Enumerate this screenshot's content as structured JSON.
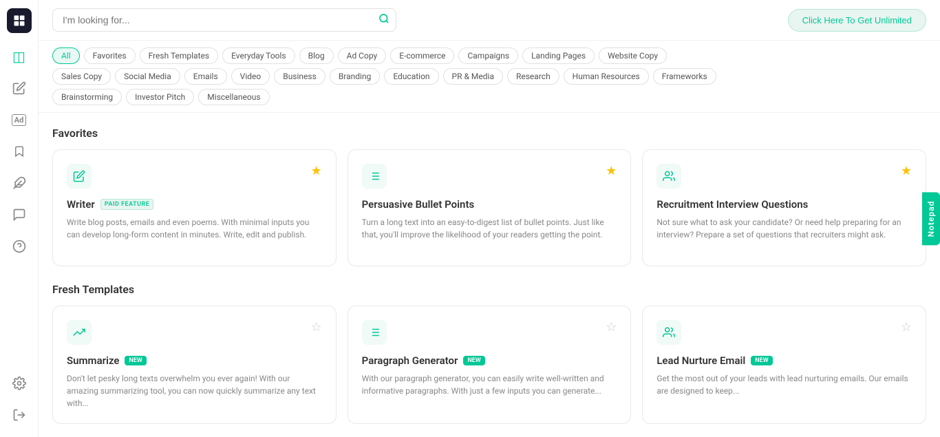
{
  "sidebar": {
    "logo_label": "Logo",
    "items": [
      {
        "name": "dashboard-icon",
        "icon": "⊞",
        "active": false
      },
      {
        "name": "layers-icon",
        "icon": "◫",
        "active": true
      },
      {
        "name": "edit-icon",
        "icon": "✏",
        "active": false
      },
      {
        "name": "ad-icon",
        "icon": "Ad",
        "active": false
      },
      {
        "name": "bookmark-icon",
        "icon": "🔖",
        "active": false
      },
      {
        "name": "puzzle-icon",
        "icon": "✦",
        "active": false
      },
      {
        "name": "comment-icon",
        "icon": "💬",
        "active": false
      },
      {
        "name": "help-icon",
        "icon": "?",
        "active": false
      }
    ],
    "bottom_items": [
      {
        "name": "settings-icon",
        "icon": "⚙",
        "active": false
      },
      {
        "name": "logout-icon",
        "icon": "→",
        "active": false
      }
    ]
  },
  "topbar": {
    "search_placeholder": "I'm looking for...",
    "unlimited_button": "Click Here To Get Unlimited"
  },
  "filters": {
    "rows": [
      [
        "All",
        "Favorites",
        "Fresh Templates",
        "Everyday Tools",
        "Blog",
        "Ad Copy",
        "E-commerce",
        "Campaigns",
        "Landing Pages",
        "Website Copy"
      ],
      [
        "Sales Copy",
        "Social Media",
        "Emails",
        "Video",
        "Business",
        "Branding",
        "Education",
        "PR & Media",
        "Research",
        "Human Resources",
        "Frameworks"
      ],
      [
        "Brainstorming",
        "Investor Pitch",
        "Miscellaneous"
      ]
    ],
    "active": "All"
  },
  "sections": [
    {
      "title": "Favorites",
      "cards": [
        {
          "icon": "✏",
          "title": "Writer",
          "badge": "PAID FEATURE",
          "badge_type": "paid",
          "starred": true,
          "description": "Write blog posts, emails and even poems. With minimal inputs you can develop long-form content in minutes. Write, edit and publish."
        },
        {
          "icon": "≡",
          "title": "Persuasive Bullet Points",
          "badge": "",
          "badge_type": "",
          "starred": true,
          "description": "Turn a long text into an easy-to-digest list of bullet points. Just like that, you'll improve the likelihood of your readers getting the point."
        },
        {
          "icon": "👤",
          "title": "Recruitment Interview Questions",
          "badge": "",
          "badge_type": "",
          "starred": true,
          "description": "Not sure what to ask your candidate? Or need help preparing for an interview? Prepare a set of questions that recruiters might ask."
        }
      ]
    },
    {
      "title": "Fresh Templates",
      "cards": [
        {
          "icon": "✂",
          "title": "Summarize",
          "badge": "NEW",
          "badge_type": "new",
          "starred": false,
          "description": "Don't let pesky long texts overwhelm you ever again! With our amazing summarizing tool, you can now quickly summarize any text with..."
        },
        {
          "icon": "≡",
          "title": "Paragraph Generator",
          "badge": "NEW",
          "badge_type": "new",
          "starred": false,
          "description": "With our paragraph generator, you can easily write well-written and informative paragraphs. With just a few inputs you can generate..."
        },
        {
          "icon": "👤",
          "title": "Lead Nurture Email",
          "badge": "NEW",
          "badge_type": "new",
          "starred": false,
          "description": "Get the most out of your leads with lead nurturing emails. Our emails are designed to keep..."
        }
      ]
    }
  ],
  "notepad": {
    "label": "Notepad"
  }
}
